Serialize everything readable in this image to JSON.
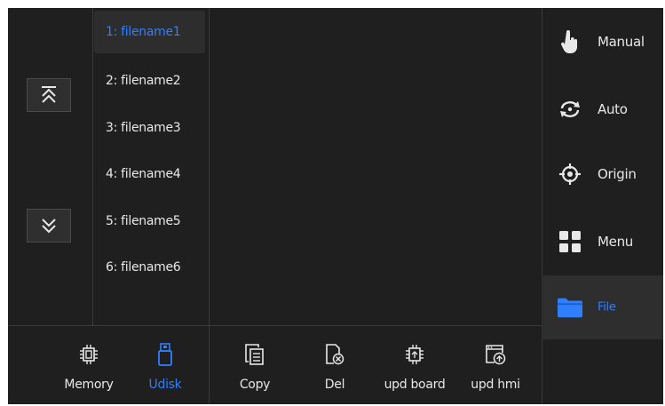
{
  "file_list": {
    "items": [
      {
        "label": "1: filename1",
        "selected": true
      },
      {
        "label": "2: filename2",
        "selected": false
      },
      {
        "label": "3: filename3",
        "selected": false
      },
      {
        "label": "4: filename4",
        "selected": false
      },
      {
        "label": "5: filename5",
        "selected": false
      },
      {
        "label": "6: filename6",
        "selected": false
      }
    ],
    "scroll_up_icon": "double-chevron-up-icon",
    "scroll_down_icon": "double-chevron-down-icon"
  },
  "sidebar": {
    "items": [
      {
        "label": "Manual",
        "icon": "hand-pointer-icon"
      },
      {
        "label": "Auto",
        "icon": "auto-cycle-icon"
      },
      {
        "label": "Origin",
        "icon": "crosshair-icon"
      },
      {
        "label": "Menu",
        "icon": "grid-icon"
      },
      {
        "label": "File",
        "icon": "folder-icon",
        "active": true
      }
    ]
  },
  "storage": {
    "memory_label": "Memory",
    "udisk_label": "Udisk",
    "active": "Udisk"
  },
  "actions": {
    "copy_label": "Copy",
    "del_label": "Del",
    "upd_board_label": "upd board",
    "upd_hmi_label": "upd hmi"
  },
  "colors": {
    "accent": "#2f7fff",
    "background": "#1f1f1f",
    "text": "#e8e8e8"
  }
}
